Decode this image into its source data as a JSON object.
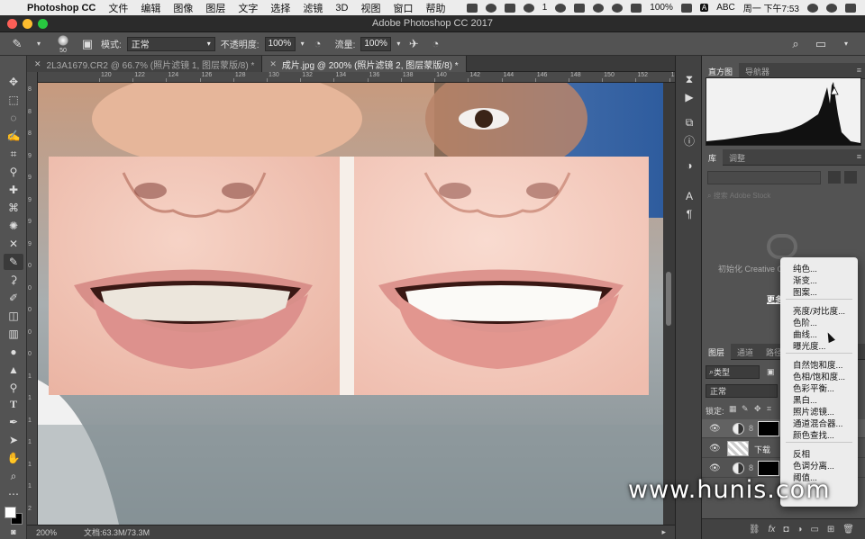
{
  "menubar": {
    "app": "Photoshop CC",
    "menus": [
      "文件",
      "编辑",
      "图像",
      "图层",
      "文字",
      "选择",
      "滤镜",
      "3D",
      "视图",
      "窗口",
      "帮助"
    ],
    "wechat_badge": "1",
    "battery": "100%",
    "input_method": "A",
    "input_name": "ABC",
    "clock": "周一 下午7:53"
  },
  "window": {
    "title": "Adobe Photoshop CC 2017",
    "traffic_colors": [
      "#fc5f57",
      "#fdbc2e",
      "#28c840"
    ]
  },
  "options": {
    "brush_size": "50",
    "mode_label": "模式:",
    "mode_value": "正常",
    "opacity_label": "不透明度:",
    "opacity_value": "100%",
    "flow_label": "流量:",
    "flow_value": "100%"
  },
  "tabs": [
    {
      "label": "2L3A1679.CR2 @ 66.7% (照片滤镜 1, 图层蒙版/8) *"
    },
    {
      "label": "成片.jpg @ 200% (照片滤镜 2, 图层蒙版/8) *"
    }
  ],
  "ruler": {
    "top_labels": [
      "120",
      "122",
      "124",
      "126",
      "128",
      "130",
      "132",
      "134",
      "136",
      "138",
      "140",
      "142",
      "144",
      "146",
      "148",
      "150",
      "152",
      "154",
      "156"
    ],
    "left_labels": [
      "8",
      "8",
      "8",
      "9",
      "9",
      "9",
      "9",
      "9",
      "0",
      "0",
      "0",
      "0",
      "0",
      "1",
      "1",
      "1",
      "1",
      "1",
      "1",
      "2"
    ]
  },
  "status": {
    "zoom": "200%",
    "doc": "文档:63.3M/73.3M"
  },
  "panels": {
    "histogram_tabs": [
      "直方图",
      "导航器"
    ],
    "library_tabs": [
      "库",
      "调整"
    ],
    "library_search": "搜索 Adobe Stock",
    "library_msg": "初始化 Creative C",
    "library_link": "更多",
    "layers_tabs": [
      "图层",
      "通道",
      "路径"
    ],
    "layers_filter": "类型",
    "layers_blend": "正常",
    "lock_label": "锁定:",
    "layer_names": [
      "",
      "下载",
      ""
    ]
  },
  "adjust_menu": {
    "groups": [
      [
        "纯色...",
        "渐变...",
        "图案..."
      ],
      [
        "亮度/对比度...",
        "色阶...",
        "曲线...",
        "曝光度..."
      ],
      [
        "自然饱和度...",
        "色相/饱和度...",
        "色彩平衡...",
        "黑白...",
        "照片滤镜...",
        "通道混合器...",
        "颜色查找..."
      ],
      [
        "反相",
        "色调分离...",
        "阈值..."
      ]
    ]
  },
  "watermark": "www.hunis.com"
}
